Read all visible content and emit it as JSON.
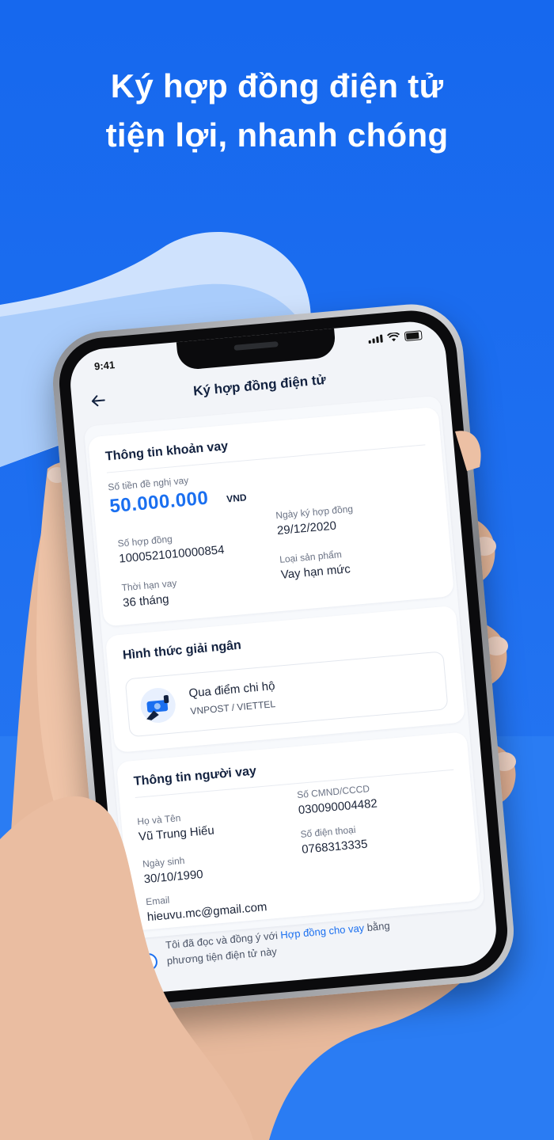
{
  "headline": {
    "line1": "Ký hợp đồng điện tử",
    "line2": "tiện lợi, nhanh chóng"
  },
  "colors": {
    "brand_blue": "#1a6ff0",
    "light_wave": "#dbe9fd",
    "text_dark": "#12213f"
  },
  "status_bar": {
    "time": "9:41",
    "icons": [
      "signal-icon",
      "wifi-icon",
      "battery-icon"
    ]
  },
  "app": {
    "title": "Ký hợp đồng điện tử",
    "back_icon": "arrow-left-icon"
  },
  "loan_info": {
    "title": "Thông tin khoản vay",
    "amount_label": "Số tiền đề nghị vay",
    "amount_value": "50.000.000",
    "amount_unit": "VND",
    "contract_date_label": "Ngày ký hợp đồng",
    "contract_date_value": "29/12/2020",
    "contract_no_label": "Số hợp đồng",
    "contract_no_value": "100052101000085­4",
    "product_label": "Loại sản phẩm",
    "product_value": "Vay hạn mức",
    "term_label": "Thời hạn vay",
    "term_value": "36 tháng"
  },
  "disbursement": {
    "title": "Hình thức giải ngân",
    "method_name": "Qua điểm chi hộ",
    "method_sub": "VNPOST / VIETTEL",
    "method_icon": "cash-pickup-icon"
  },
  "borrower": {
    "title": "Thông tin người vay",
    "id_label": "Số CMND/CCCD",
    "id_value": "030090004482",
    "name_label": "Họ và Tên",
    "name_value": "Vũ Trung Hiếu",
    "phone_label": "Số điện thoại",
    "phone_value": "0768313335",
    "dob_label": "Ngày sinh",
    "dob_value": "30/10/1990",
    "email_label": "Email",
    "email_value": "hieuvu.mc@gmail.com"
  },
  "agreement": {
    "prefix": "Tôi đã đọc và đồng ý với ",
    "link": "Hợp đồng cho vay",
    "suffix": " bằng",
    "line2": "phương tiện điện tử này"
  }
}
